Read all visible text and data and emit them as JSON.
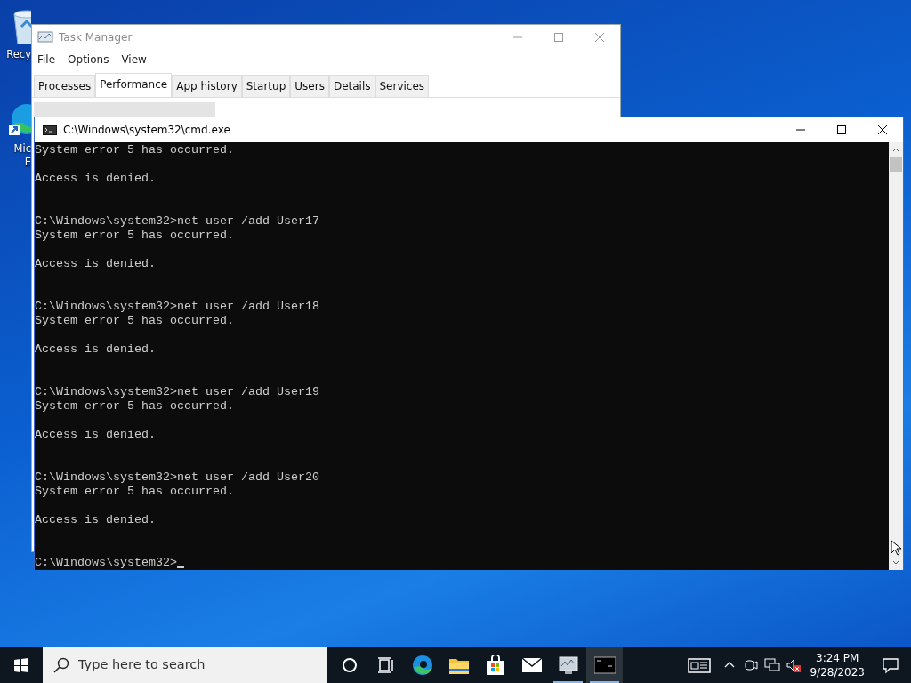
{
  "desktop": {
    "icons": [
      {
        "kind": "recycle-bin",
        "label_lines": [
          "Recy"
        ]
      },
      {
        "kind": "edge-shortcut",
        "label_lines": [
          "Mic",
          "E"
        ]
      }
    ]
  },
  "task_manager": {
    "title": "Task Manager",
    "menu": [
      "File",
      "Options",
      "View"
    ],
    "tabs": [
      {
        "label": "Processes",
        "selected": false
      },
      {
        "label": "Performance",
        "selected": true
      },
      {
        "label": "App history",
        "selected": false
      },
      {
        "label": "Startup",
        "selected": false
      },
      {
        "label": "Users",
        "selected": false
      },
      {
        "label": "Details",
        "selected": false
      },
      {
        "label": "Services",
        "selected": false
      }
    ]
  },
  "cmd": {
    "title": "C:\\Windows\\system32\\cmd.exe",
    "blocks": [
      {
        "output": [
          "System error 5 has occurred.",
          "Access is denied."
        ]
      },
      {
        "prompt": "C:\\Windows\\system32>",
        "command": "net user /add User17",
        "output": [
          "System error 5 has occurred.",
          "Access is denied."
        ]
      },
      {
        "prompt": "C:\\Windows\\system32>",
        "command": "net user /add User18",
        "output": [
          "System error 5 has occurred.",
          "Access is denied."
        ]
      },
      {
        "prompt": "C:\\Windows\\system32>",
        "command": "net user /add User19",
        "output": [
          "System error 5 has occurred.",
          "Access is denied."
        ]
      },
      {
        "prompt": "C:\\Windows\\system32>",
        "command": "net user /add User20",
        "output": [
          "System error 5 has occurred.",
          "Access is denied."
        ]
      }
    ],
    "current_prompt": "C:\\Windows\\system32>"
  },
  "taskbar": {
    "search": {
      "placeholder": "Type here to search"
    },
    "apps": [
      {
        "kind": "cortana",
        "open": false,
        "active": false
      },
      {
        "kind": "task-view",
        "open": false,
        "active": false
      },
      {
        "kind": "edge",
        "open": false,
        "active": false
      },
      {
        "kind": "explorer",
        "open": false,
        "active": false
      },
      {
        "kind": "store",
        "open": false,
        "active": false
      },
      {
        "kind": "mail",
        "open": false,
        "active": false
      },
      {
        "kind": "task-manager",
        "open": true,
        "active": false
      },
      {
        "kind": "cmd",
        "open": true,
        "active": true
      }
    ],
    "clock": {
      "time": "3:24 PM",
      "date": "9/28/2023"
    }
  }
}
